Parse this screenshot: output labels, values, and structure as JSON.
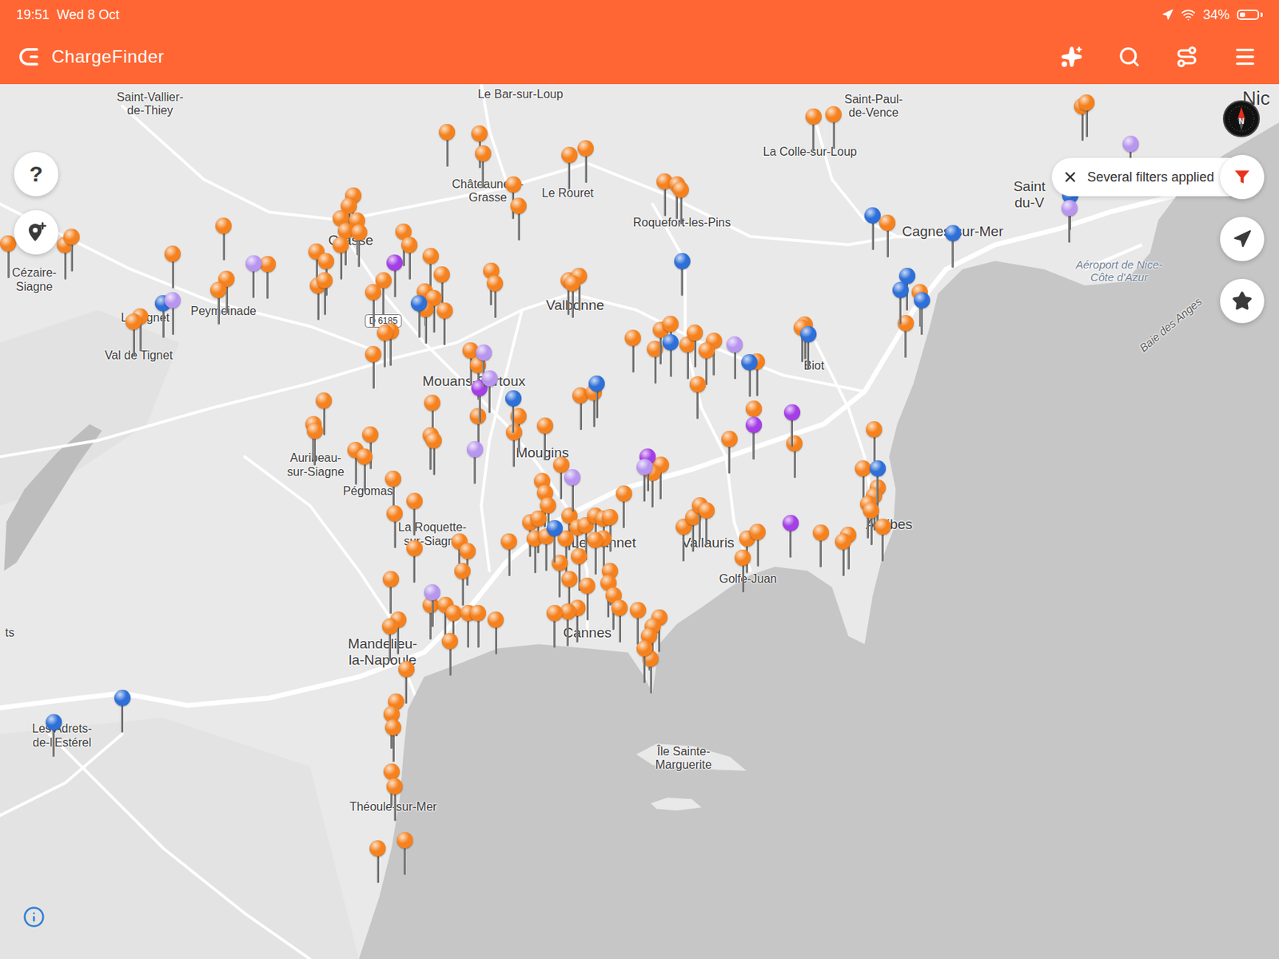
{
  "status_bar": {
    "time": "19:51",
    "date": "Wed 8 Oct",
    "battery": {
      "reading": "34%",
      "level": 0.34
    }
  },
  "app_bar": {
    "title": "ChargeFinder"
  },
  "help_button": {
    "label": "?"
  },
  "compass": {
    "label": "N"
  },
  "filter_chip": {
    "label": "Several filters applied"
  },
  "map": {
    "labels": [
      {
        "lines": [
          "Saint-Vallier-",
          "de-Thiey"
        ],
        "kind": "place"
      },
      {
        "lines": [
          "Le Bar-sur-Loup"
        ],
        "kind": "place"
      },
      {
        "lines": [
          "Saint-Paul-",
          "de-Vence"
        ],
        "kind": "place"
      },
      {
        "lines": [
          "La Colle-sur-Loup"
        ],
        "kind": "place"
      },
      {
        "lines": [
          "Châteauneuf-",
          "Grasse"
        ],
        "kind": "place"
      },
      {
        "lines": [
          "Le Rouret"
        ],
        "kind": "place"
      },
      {
        "lines": [
          "Roquefort-les-Pins"
        ],
        "kind": "place"
      },
      {
        "lines": [
          "Cagnes-sur-Mer"
        ],
        "kind": "town"
      },
      {
        "lines": [
          "Saint",
          "du-V"
        ],
        "kind": "town"
      },
      {
        "lines": [
          "Aéroport de Nice-",
          "Côte d'Azur"
        ],
        "kind": "airport"
      },
      {
        "lines": [
          "Baie des Anges"
        ],
        "kind": "bay"
      },
      {
        "lines": [
          "Nic"
        ],
        "kind": "city"
      },
      {
        "lines": [
          "Cézaire-",
          "Siagne"
        ],
        "kind": "place"
      },
      {
        "lines": [
          "Peymeinade"
        ],
        "kind": "place"
      },
      {
        "lines": [
          "Le Tignet"
        ],
        "kind": "place"
      },
      {
        "lines": [
          "Val de Tignet"
        ],
        "kind": "place"
      },
      {
        "lines": [
          "Grasse"
        ],
        "kind": "town"
      },
      {
        "lines": [
          "Valbonne"
        ],
        "kind": "town"
      },
      {
        "lines": [
          "Mouans-Sartoux"
        ],
        "kind": "town"
      },
      {
        "lines": [
          "Biot"
        ],
        "kind": "place"
      },
      {
        "lines": [
          "Mougins"
        ],
        "kind": "town"
      },
      {
        "lines": [
          "Auribeau-",
          "sur-Siagne"
        ],
        "kind": "place"
      },
      {
        "lines": [
          "Pégomas"
        ],
        "kind": "place"
      },
      {
        "lines": [
          "La Roquette-",
          "sur-Siagne"
        ],
        "kind": "place"
      },
      {
        "lines": [
          "Le Cannet"
        ],
        "kind": "town"
      },
      {
        "lines": [
          "Vallauris"
        ],
        "kind": "town"
      },
      {
        "lines": [
          "Golfe-Juan"
        ],
        "kind": "place"
      },
      {
        "lines": [
          "Antibes"
        ],
        "kind": "town"
      },
      {
        "lines": [
          "Cannes"
        ],
        "kind": "town"
      },
      {
        "lines": [
          "Mandelieu-",
          "la-Napoule"
        ],
        "kind": "town"
      },
      {
        "lines": [
          "Les Adrets-",
          "de-l'Estérel"
        ],
        "kind": "place"
      },
      {
        "lines": [
          "Théoule-sur-Mer"
        ],
        "kind": "place"
      },
      {
        "lines": [
          "Île Sainte-",
          "Marguerite"
        ],
        "kind": "island"
      },
      {
        "lines": [
          "ts"
        ],
        "kind": "place"
      }
    ],
    "road_shields": [
      {
        "text": "D 6185"
      }
    ],
    "pins": [
      {
        "color": "#f5821f"
      },
      {
        "color": "#f5821f"
      },
      {
        "color": "#f5821f"
      },
      {
        "color": "#f5821f"
      },
      {
        "color": "#f5821f"
      },
      {
        "color": "#f5821f"
      },
      {
        "color": "#f5821f"
      },
      {
        "color": "#f5821f"
      },
      {
        "color": "#f5821f"
      },
      {
        "color": "#f5821f"
      },
      {
        "color": "#f5821f"
      },
      {
        "color": "#f5821f"
      },
      {
        "color": "#f5821f"
      },
      {
        "color": "#f5821f"
      },
      {
        "color": "#f5821f"
      },
      {
        "color": "#f5821f"
      },
      {
        "color": "#f5821f"
      },
      {
        "color": "#f5821f"
      },
      {
        "color": "#f5821f"
      },
      {
        "color": "#f5821f"
      },
      {
        "color": "#f5821f"
      },
      {
        "color": "#f5821f"
      },
      {
        "color": "#f5821f"
      },
      {
        "color": "#f5821f"
      },
      {
        "color": "#f5821f"
      },
      {
        "color": "#f5821f"
      },
      {
        "color": "#f5821f"
      },
      {
        "color": "#f5821f"
      },
      {
        "color": "#f5821f"
      },
      {
        "color": "#f5821f"
      },
      {
        "color": "#f5821f"
      },
      {
        "color": "#f5821f"
      },
      {
        "color": "#f5821f"
      },
      {
        "color": "#f5821f"
      },
      {
        "color": "#f5821f"
      },
      {
        "color": "#f5821f"
      },
      {
        "color": "#f5821f"
      },
      {
        "color": "#f5821f"
      },
      {
        "color": "#f5821f"
      },
      {
        "color": "#f5821f"
      },
      {
        "color": "#f5821f"
      },
      {
        "color": "#f5821f"
      },
      {
        "color": "#f5821f"
      },
      {
        "color": "#f5821f"
      },
      {
        "color": "#f5821f"
      },
      {
        "color": "#f5821f"
      },
      {
        "color": "#f5821f"
      },
      {
        "color": "#f5821f"
      },
      {
        "color": "#f5821f"
      },
      {
        "color": "#f5821f"
      },
      {
        "color": "#f5821f"
      },
      {
        "color": "#f5821f"
      },
      {
        "color": "#f5821f"
      },
      {
        "color": "#f5821f"
      },
      {
        "color": "#f5821f"
      },
      {
        "color": "#f5821f"
      },
      {
        "color": "#f5821f"
      },
      {
        "color": "#f5821f"
      },
      {
        "color": "#f5821f"
      },
      {
        "color": "#f5821f"
      },
      {
        "color": "#f5821f"
      },
      {
        "color": "#f5821f"
      },
      {
        "color": "#f5821f"
      },
      {
        "color": "#f5821f"
      },
      {
        "color": "#f5821f"
      },
      {
        "color": "#f5821f"
      },
      {
        "color": "#f5821f"
      },
      {
        "color": "#f5821f"
      },
      {
        "color": "#f5821f"
      },
      {
        "color": "#f5821f"
      },
      {
        "color": "#f5821f"
      },
      {
        "color": "#f5821f"
      },
      {
        "color": "#f5821f"
      },
      {
        "color": "#f5821f"
      },
      {
        "color": "#f5821f"
      },
      {
        "color": "#f5821f"
      },
      {
        "color": "#f5821f"
      },
      {
        "color": "#f5821f"
      },
      {
        "color": "#f5821f"
      },
      {
        "color": "#f5821f"
      },
      {
        "color": "#f5821f"
      },
      {
        "color": "#f5821f"
      },
      {
        "color": "#f5821f"
      },
      {
        "color": "#f5821f"
      },
      {
        "color": "#f5821f"
      },
      {
        "color": "#f5821f"
      },
      {
        "color": "#f5821f"
      },
      {
        "color": "#f5821f"
      },
      {
        "color": "#f5821f"
      },
      {
        "color": "#f5821f"
      },
      {
        "color": "#f5821f"
      },
      {
        "color": "#f5821f"
      },
      {
        "color": "#f5821f"
      },
      {
        "color": "#f5821f"
      },
      {
        "color": "#f5821f"
      },
      {
        "color": "#f5821f"
      },
      {
        "color": "#f5821f"
      },
      {
        "color": "#f5821f"
      },
      {
        "color": "#f5821f"
      },
      {
        "color": "#f5821f"
      },
      {
        "color": "#f5821f"
      },
      {
        "color": "#f5821f"
      },
      {
        "color": "#f5821f"
      },
      {
        "color": "#f5821f"
      },
      {
        "color": "#f5821f"
      },
      {
        "color": "#f5821f"
      },
      {
        "color": "#f5821f"
      },
      {
        "color": "#f5821f"
      },
      {
        "color": "#f5821f"
      },
      {
        "color": "#f5821f"
      },
      {
        "color": "#f5821f"
      },
      {
        "color": "#f5821f"
      },
      {
        "color": "#f5821f"
      },
      {
        "color": "#f5821f"
      },
      {
        "color": "#f5821f"
      },
      {
        "color": "#f5821f"
      },
      {
        "color": "#f5821f"
      },
      {
        "color": "#f5821f"
      },
      {
        "color": "#f5821f"
      },
      {
        "color": "#f5821f"
      },
      {
        "color": "#f5821f"
      },
      {
        "color": "#f5821f"
      },
      {
        "color": "#f5821f"
      },
      {
        "color": "#f5821f"
      },
      {
        "color": "#f5821f"
      },
      {
        "color": "#f5821f"
      },
      {
        "color": "#f5821f"
      },
      {
        "color": "#f5821f"
      },
      {
        "color": "#f5821f"
      },
      {
        "color": "#f5821f"
      },
      {
        "color": "#f5821f"
      },
      {
        "color": "#f5821f"
      },
      {
        "color": "#f5821f"
      },
      {
        "color": "#f5821f"
      },
      {
        "color": "#f5821f"
      },
      {
        "color": "#f5821f"
      },
      {
        "color": "#f5821f"
      },
      {
        "color": "#f5821f"
      },
      {
        "color": "#f5821f"
      },
      {
        "color": "#f5821f"
      },
      {
        "color": "#f5821f"
      },
      {
        "color": "#f5821f"
      },
      {
        "color": "#f5821f"
      },
      {
        "color": "#f5821f"
      },
      {
        "color": "#f5821f"
      },
      {
        "color": "#f5821f"
      },
      {
        "color": "#f5821f"
      },
      {
        "color": "#f5821f"
      },
      {
        "color": "#f5821f"
      },
      {
        "color": "#f5821f"
      },
      {
        "color": "#f5821f"
      },
      {
        "color": "#f5821f"
      },
      {
        "color": "#f5821f"
      },
      {
        "color": "#f5821f"
      },
      {
        "color": "#f5821f"
      },
      {
        "color": "#f5821f"
      },
      {
        "color": "#f5821f"
      },
      {
        "color": "#f5821f"
      },
      {
        "color": "#f5821f"
      },
      {
        "color": "#f5821f"
      },
      {
        "color": "#f5821f"
      },
      {
        "color": "#f5821f"
      },
      {
        "color": "#f5821f"
      },
      {
        "color": "#f5821f"
      },
      {
        "color": "#f5821f"
      },
      {
        "color": "#f5821f"
      },
      {
        "color": "#f5821f"
      },
      {
        "color": "#f5821f"
      },
      {
        "color": "#2e6fd8"
      },
      {
        "color": "#2e6fd8"
      },
      {
        "color": "#2e6fd8"
      },
      {
        "color": "#2e6fd8"
      },
      {
        "color": "#2e6fd8"
      },
      {
        "color": "#2e6fd8"
      },
      {
        "color": "#2e6fd8"
      },
      {
        "color": "#2e6fd8"
      },
      {
        "color": "#2e6fd8"
      },
      {
        "color": "#2e6fd8"
      },
      {
        "color": "#2e6fd8"
      },
      {
        "color": "#2e6fd8"
      },
      {
        "color": "#2e6fd8"
      },
      {
        "color": "#2e6fd8"
      },
      {
        "color": "#2e6fd8"
      },
      {
        "color": "#2e6fd8"
      },
      {
        "color": "#2e6fd8"
      },
      {
        "color": "#2e6fd8"
      },
      {
        "color": "#a43ee6"
      },
      {
        "color": "#a43ee6"
      },
      {
        "color": "#a43ee6"
      },
      {
        "color": "#a43ee6"
      },
      {
        "color": "#a43ee6"
      },
      {
        "color": "#a43ee6"
      },
      {
        "color": "#b895ee"
      },
      {
        "color": "#b895ee"
      },
      {
        "color": "#b895ee"
      },
      {
        "color": "#b895ee"
      },
      {
        "color": "#b895ee"
      },
      {
        "color": "#b895ee"
      },
      {
        "color": "#b895ee"
      },
      {
        "color": "#b895ee"
      },
      {
        "color": "#b895ee"
      },
      {
        "color": "#b895ee"
      },
      {
        "color": "#b895ee"
      }
    ]
  }
}
